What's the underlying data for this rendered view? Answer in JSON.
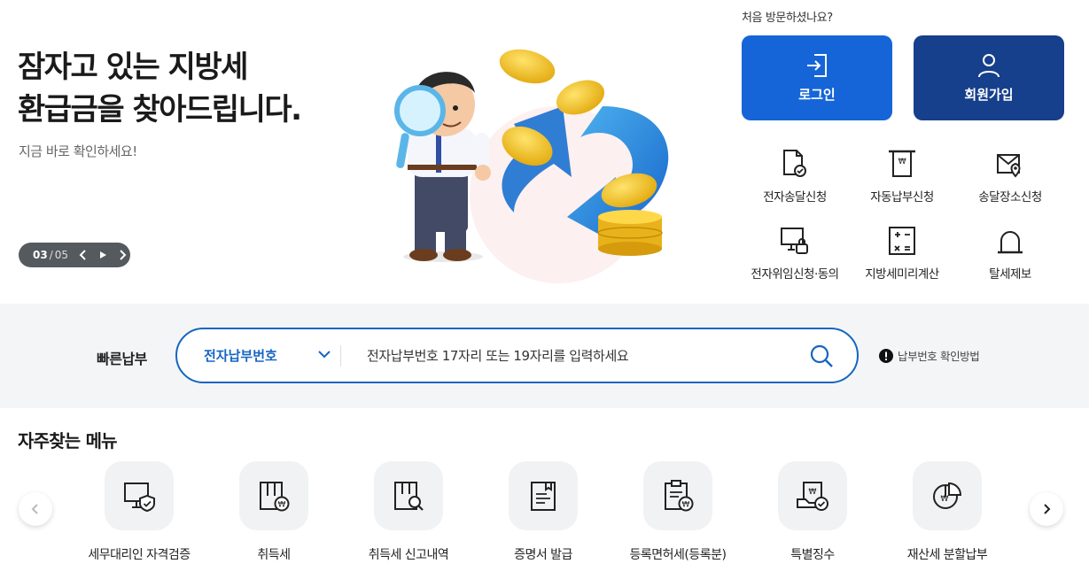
{
  "hero": {
    "title_line1": "잠자고 있는 지방세",
    "title_line2": "환급금을 찾아드립니다.",
    "subtitle": "지금 바로 확인하세요!",
    "slide": {
      "current": "03",
      "separator": "/",
      "total": "05"
    }
  },
  "account": {
    "first_visit": "처음 방문하셨나요?",
    "login_label": "로그인",
    "join_label": "회원가입",
    "login_color": "#1565d8",
    "join_color": "#163f8c"
  },
  "quick_menu": [
    {
      "label": "전자송달신청",
      "icon": "document-check-icon"
    },
    {
      "label": "자동납부신청",
      "icon": "auto-payment-icon"
    },
    {
      "label": "송달장소신청",
      "icon": "location-mail-icon"
    },
    {
      "label": "전자위임신청·동의",
      "icon": "monitor-lock-icon"
    },
    {
      "label": "지방세미리계산",
      "icon": "calculator-icon"
    },
    {
      "label": "탈세제보",
      "icon": "alarm-bell-icon"
    }
  ],
  "search": {
    "label": "빠른납부",
    "select_value": "전자납부번호",
    "placeholder": "전자납부번호 17자리 또는 19자리를 입력하세요",
    "help_label": "납부번호 확인방법",
    "accent_color": "#1565c0"
  },
  "frequent": {
    "title": "자주찾는 메뉴",
    "items": [
      {
        "label": "세무대리인 자격검증",
        "icon": "monitor-shield-icon"
      },
      {
        "label": "취득세",
        "icon": "acquisition-tax-icon"
      },
      {
        "label": "취득세 신고내역",
        "icon": "report-search-icon"
      },
      {
        "label": "증명서 발급",
        "icon": "certificate-icon"
      },
      {
        "label": "등록면허세(등록분)",
        "icon": "clipboard-won-icon"
      },
      {
        "label": "특별징수",
        "icon": "special-collection-icon"
      },
      {
        "label": "재산세 분할납부",
        "icon": "pie-won-icon"
      }
    ]
  }
}
